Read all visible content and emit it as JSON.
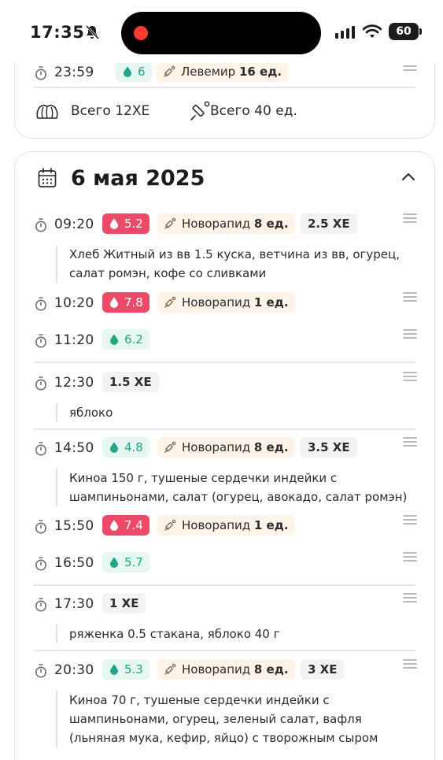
{
  "status_bar": {
    "time": "17:35",
    "battery": "60"
  },
  "top_card": {
    "entry": {
      "time": "23:59",
      "glucose": "6",
      "insulin_name": "Левемир",
      "insulin_dose": "16 ед."
    },
    "totals": {
      "xe_label": "Всего 12ХЕ",
      "units_label": "Всего 40 ед."
    }
  },
  "day": {
    "title": "6 мая 2025",
    "entries": [
      {
        "time": "09:20",
        "glucose": "5.2",
        "glucose_level": "high",
        "insulin_name": "Новорапид",
        "insulin_dose": "8 ед.",
        "xe": "2.5 ХЕ",
        "note": "Хлеб Житный из вв 1.5 куска, ветчина из вв, огурец, салат ромэн, кофе со сливками"
      },
      {
        "time": "10:20",
        "glucose": "7.8",
        "glucose_level": "high",
        "insulin_name": "Новорапид",
        "insulin_dose": "1 ед."
      },
      {
        "time": "11:20",
        "glucose": "6.2",
        "glucose_level": "ok"
      },
      {
        "time": "12:30",
        "xe": "1.5 ХЕ",
        "note": "яблоко"
      },
      {
        "time": "14:50",
        "glucose": "4.8",
        "glucose_level": "ok",
        "insulin_name": "Новорапид",
        "insulin_dose": "8 ед.",
        "xe": "3.5 ХЕ",
        "note": "Киноа 150 г, тушеные сердечки индейки с шампиньонами, салат (огурец, авокадо, салат ромэн)"
      },
      {
        "time": "15:50",
        "glucose": "7.4",
        "glucose_level": "high",
        "insulin_name": "Новорапид",
        "insulin_dose": "1 ед."
      },
      {
        "time": "16:50",
        "glucose": "5.7",
        "glucose_level": "ok"
      },
      {
        "time": "17:30",
        "xe": "1 ХЕ",
        "note": "ряженка 0.5 стакана, яблоко 40 г"
      },
      {
        "time": "20:30",
        "glucose": "5.3",
        "glucose_level": "ok",
        "insulin_name": "Новорапид",
        "insulin_dose": "8 ед.",
        "xe": "3 ХЕ",
        "note": "Киноа 70 г, тушеные сердечки индейки с шампиньонами, огурец, зеленый салат, вафля (льняная мука, кефир, яйцо) с творожным сыром"
      }
    ]
  },
  "colors": {
    "glucose_ok_bg": "#e6f6f1",
    "glucose_ok_text": "#22a58a",
    "glucose_high_bg": "#ec4a68",
    "insulin_bg": "#fdf3e7",
    "xe_bg": "#f4f1f4",
    "border": "#e2e2e6"
  },
  "icons": [
    "bell-slash-icon",
    "signal-icon",
    "wifi-icon",
    "battery-icon",
    "clock-icon",
    "drop-icon",
    "syringe-icon",
    "drag-handle-icon",
    "calendar-icon",
    "chevron-up-icon",
    "bread-icon"
  ]
}
